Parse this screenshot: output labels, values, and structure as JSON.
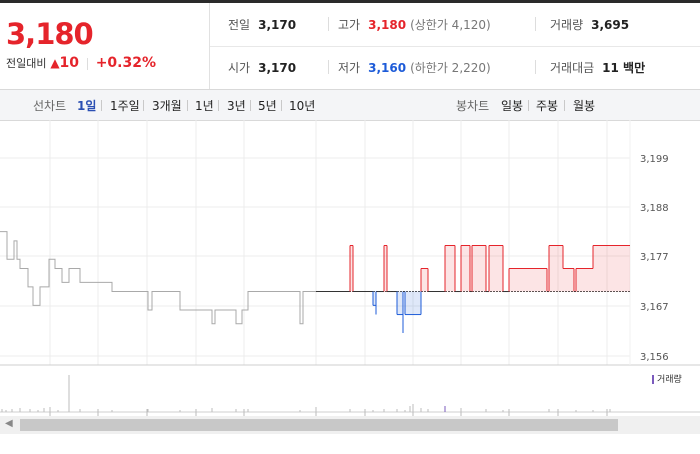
{
  "quote": {
    "price": "3,180",
    "change_label": "전일대비",
    "change_arrow": "▲",
    "change_value": "10",
    "change_pct": "+0.32%"
  },
  "stats": {
    "prev_close": {
      "label": "전일",
      "value": "3,170"
    },
    "high": {
      "label": "고가",
      "value": "3,180",
      "limit": "(상한가 4,120)"
    },
    "volume": {
      "label": "거래량",
      "value": "3,695"
    },
    "open": {
      "label": "시가",
      "value": "3,170"
    },
    "low": {
      "label": "저가",
      "value": "3,160",
      "limit": "(하한가 2,220)"
    },
    "amount": {
      "label": "거래대금",
      "value": "11 백만"
    }
  },
  "tabs": {
    "line_label": "선차트",
    "line_tabs": [
      "1일",
      "1주일",
      "3개월",
      "1년",
      "3년",
      "5년",
      "10년"
    ],
    "candle_label": "봉차트",
    "candle_tabs": [
      "일봉",
      "주봉",
      "월봉"
    ],
    "active": "1일"
  },
  "colors": {
    "up": "#e5242b",
    "down": "#1d5bd8",
    "volume": "#7b5bbd"
  },
  "chart_data": {
    "type": "line",
    "y_ticks": [
      "3,199",
      "3,188",
      "3,177",
      "3,167",
      "3,156"
    ],
    "ylim": [
      3156,
      3199
    ],
    "baseline": 3170,
    "volume_legend": "거래량",
    "grid": true
  }
}
